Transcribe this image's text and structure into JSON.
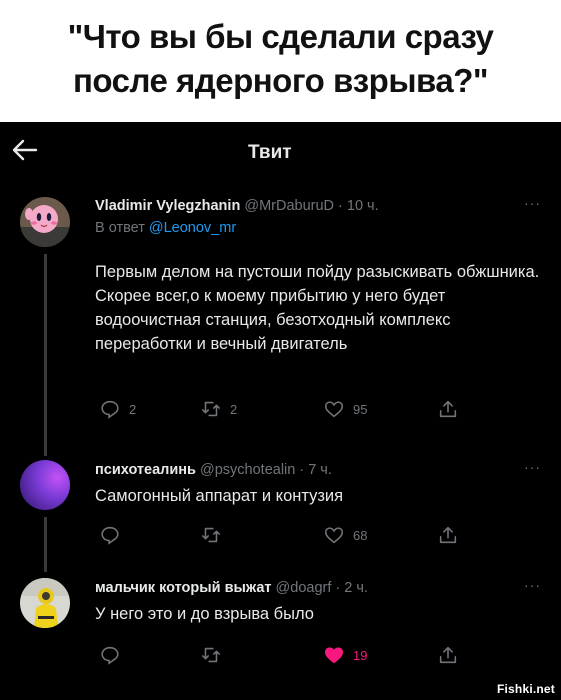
{
  "caption": {
    "line1": "\"Что вы бы сделали сразу",
    "line2": "после ядерного взрыва?\""
  },
  "header": {
    "title": "Твит",
    "back_icon": "arrow-left-icon"
  },
  "tweets": [
    {
      "name": "Vladimir Vylegzhanin",
      "handle": "@MrDaburuD",
      "time": "· 10 ч.",
      "more": "···",
      "reply_prefix": "В ответ",
      "reply_to": "@Leonov_mr",
      "text": "Первым делом на пустоши пойду разыскивать обжшника. Скорее всег,о к моему прибытию у него будет водоочистная станция, безотходный комплекс переработки и вечный двигатель",
      "replies": "2",
      "retweets": "2",
      "likes": "95",
      "liked": false
    },
    {
      "name": "психотеалинь",
      "handle": "@psychotealin",
      "time": "· 7 ч.",
      "more": "···",
      "text": "Самогонный аппарат и контузия",
      "replies": "",
      "retweets": "",
      "likes": "68",
      "liked": false
    },
    {
      "name": "мальчик который выжат",
      "handle": "@doagrf",
      "time": "· 2 ч.",
      "more": "···",
      "text": "У него это и до взрыва было",
      "replies": "",
      "retweets": "",
      "likes": "19",
      "liked": true
    }
  ],
  "colors": {
    "background": "#000000",
    "text": "#e7e9ea",
    "muted": "#71767b",
    "link": "#1d9bf0",
    "like": "#f91880"
  },
  "watermark": "Fishki.net"
}
